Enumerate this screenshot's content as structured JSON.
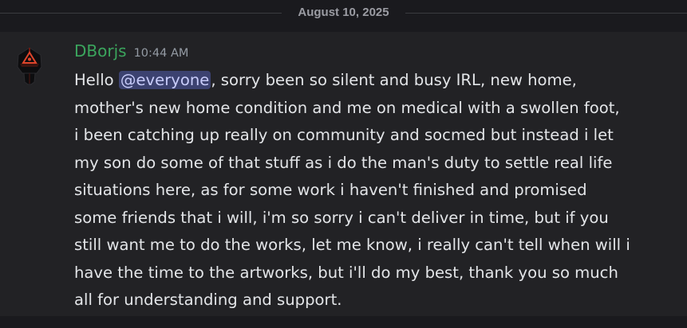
{
  "date_divider": "August 10, 2025",
  "message": {
    "username": "DBorjs",
    "timestamp": "10:44 AM",
    "greeting": "Hello",
    "mention": "@everyone",
    "lines": [
      ", sorry been so silent and busy IRL, new home,",
      "mother's new home condition and me on medical with a swollen foot,",
      "i been catching up really on community and socmed but instead i let",
      "my son do some of that stuff as i do the man's duty to settle real life",
      "situations here, as for some work i haven't finished and promised",
      "some friends that i will, i'm so sorry i can't deliver in time, but if you",
      "still want me to do the works, let me know, i really can't tell when will i",
      "have the time to the artworks, but i'll do my best, thank you so much",
      "all for understanding and support."
    ]
  },
  "colors": {
    "username": "#3ba55d",
    "mention_bg": "#3c4270",
    "mention_text": "#c9cdfb",
    "background": "#222225",
    "avatar_accent": "#e0452b"
  },
  "icons": {
    "avatar": "helmeted-warrior-avatar"
  }
}
